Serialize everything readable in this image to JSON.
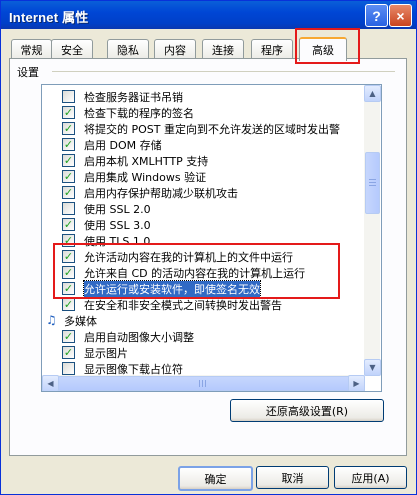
{
  "window": {
    "title": "Internet 属性",
    "help": "?",
    "close": "×"
  },
  "tabs": [
    {
      "label": "常规"
    },
    {
      "label": "安全"
    },
    {
      "label": "隐私"
    },
    {
      "label": "内容"
    },
    {
      "label": "连接"
    },
    {
      "label": "程序"
    },
    {
      "label": "高级",
      "active": true
    }
  ],
  "settings": {
    "heading": "设置",
    "rows": [
      {
        "label": "检查服务器证书吊销",
        "checked": false
      },
      {
        "label": "检查下载的程序的签名",
        "checked": true
      },
      {
        "label": "将提交的 POST 重定向到不允许发送的区域时发出警",
        "checked": true
      },
      {
        "label": "启用 DOM 存储",
        "checked": true
      },
      {
        "label": "启用本机 XMLHTTP 支持",
        "checked": true
      },
      {
        "label": "启用集成 Windows 验证",
        "checked": true
      },
      {
        "label": "启用内存保护帮助减少联机攻击",
        "checked": true
      },
      {
        "label": "使用 SSL 2.0",
        "checked": false
      },
      {
        "label": "使用 SSL 3.0",
        "checked": true
      },
      {
        "label": "使用 TLS 1.0",
        "checked": true
      },
      {
        "label": "允许活动内容在我的计算机上的文件中运行",
        "checked": true
      },
      {
        "label": "允许来自 CD 的活动内容在我的计算机上运行",
        "checked": true
      },
      {
        "label": "允许运行或安装软件，即使签名无效",
        "checked": true,
        "selected": true
      },
      {
        "label": "在安全和非安全模式之间转换时发出警告",
        "checked": true
      },
      {
        "label": "多媒体",
        "group": true,
        "icon": "multimedia-icon"
      },
      {
        "label": "启用自动图像大小调整",
        "checked": true
      },
      {
        "label": "显示图片",
        "checked": true
      },
      {
        "label": "显示图像下载占位符",
        "checked": false
      }
    ]
  },
  "buttons": {
    "restore": "还原高级设置(R)",
    "ok": "确定",
    "cancel": "取消",
    "apply": "应用(A)"
  },
  "colors": {
    "title_bar": "#0046d5",
    "highlight": "#316ac5",
    "annotation_red": "#e41a1a"
  }
}
